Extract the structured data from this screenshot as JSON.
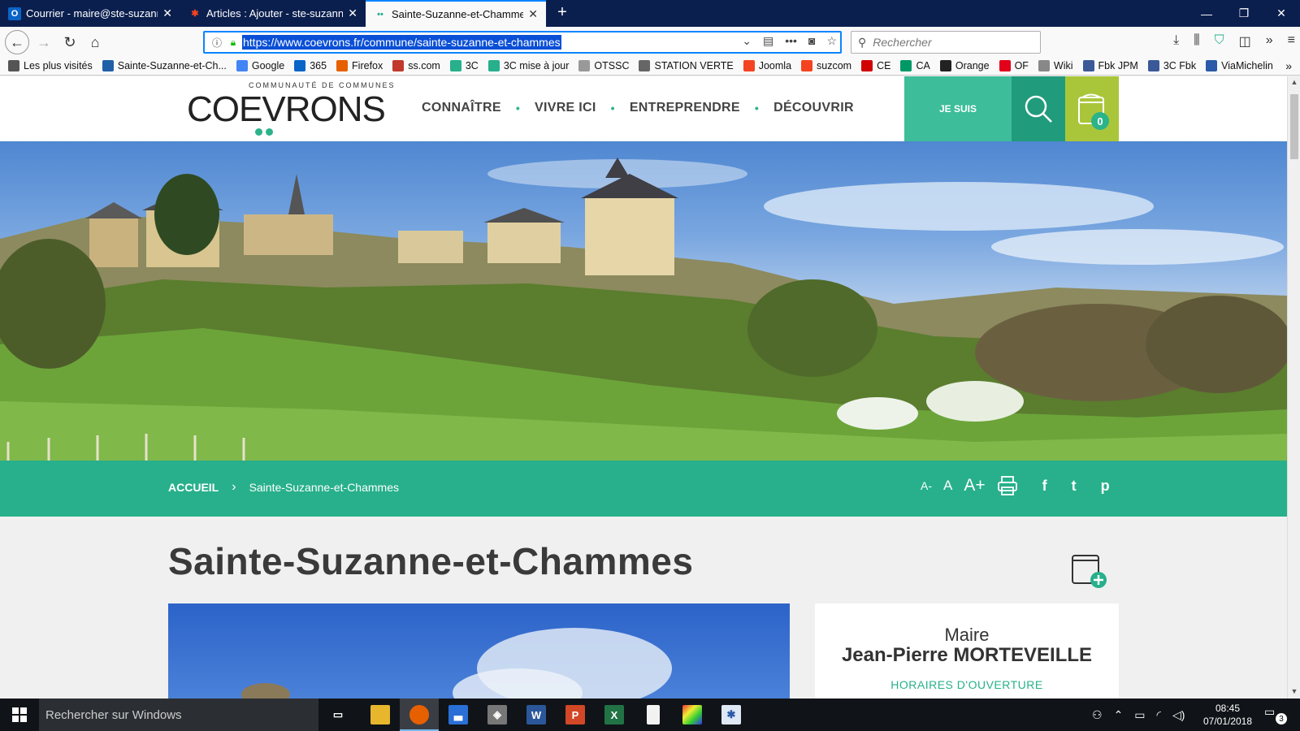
{
  "browser": {
    "tabs": [
      {
        "title": "Courrier - maire@ste-suzanne.c",
        "icon": "outlook-icon",
        "active": false
      },
      {
        "title": "Articles : Ajouter - ste-suzanne.",
        "icon": "joomla-icon",
        "active": false
      },
      {
        "title": "Sainte-Suzanne-et-Chammes |",
        "icon": "coevrons-dots-icon",
        "active": true
      }
    ],
    "url": "https://www.coevrons.fr/commune/sainte-suzanne-et-chammes",
    "search_placeholder": "Rechercher",
    "bookmarks": [
      {
        "label": "Les plus visités",
        "icon": "gear-icon",
        "color": "#555555"
      },
      {
        "label": "Sainte-Suzanne-et-Ch...",
        "icon": "site-icon",
        "color": "#1f5fa8"
      },
      {
        "label": "Google",
        "icon": "google-icon",
        "color": "#4285f4"
      },
      {
        "label": "365",
        "icon": "outlook-icon",
        "color": "#0a64c8"
      },
      {
        "label": "Firefox",
        "icon": "firefox-icon",
        "color": "#e66000"
      },
      {
        "label": "ss.com",
        "icon": "ss-icon",
        "color": "#c0392b"
      },
      {
        "label": "3C",
        "icon": "dots-icon",
        "color": "#27b08b"
      },
      {
        "label": "3C mise à jour",
        "icon": "dots-icon",
        "color": "#27b08b"
      },
      {
        "label": "OTSSC",
        "icon": "otssc-icon",
        "color": "#999999"
      },
      {
        "label": "STATION VERTE",
        "icon": "globe-icon",
        "color": "#666666"
      },
      {
        "label": "Joomla",
        "icon": "joomla-icon",
        "color": "#f44321"
      },
      {
        "label": "suzcom",
        "icon": "joomla-icon",
        "color": "#f44321"
      },
      {
        "label": "CE",
        "icon": "ce-icon",
        "color": "#d00000"
      },
      {
        "label": "CA",
        "icon": "ca-icon",
        "color": "#009966"
      },
      {
        "label": "Orange",
        "icon": "orange-icon",
        "color": "#222222"
      },
      {
        "label": "OF",
        "icon": "of-icon",
        "color": "#e2001a"
      },
      {
        "label": "Wiki",
        "icon": "wiki-icon",
        "color": "#888888"
      },
      {
        "label": "Fbk JPM",
        "icon": "facebook-icon",
        "color": "#3b5998"
      },
      {
        "label": "3C Fbk",
        "icon": "facebook-icon",
        "color": "#3b5998"
      },
      {
        "label": "ViaMichelin",
        "icon": "viamichelin-icon",
        "color": "#2a5aa8"
      }
    ]
  },
  "site": {
    "logo_small": "COMMUNAUTÉ DE COMMUNES",
    "logo_big": "COEVRONS",
    "nav": [
      "CONNAÎTRE",
      "VIVRE ICI",
      "ENTREPRENDRE",
      "DÉCOUVRIR"
    ],
    "je_suis": "JE SUIS",
    "cart_count": "0",
    "breadcrumb_home": "ACCUEIL",
    "breadcrumb_current": "Sainte-Suzanne-et-Chammes",
    "font_small": "A-",
    "font_normal": "A",
    "font_large": "A+",
    "social": {
      "facebook": "f",
      "twitter": "t",
      "pinterest": "p"
    },
    "page_title": "Sainte-Suzanne-et-Chammes",
    "mayor_role": "Maire",
    "mayor_name": "Jean-Pierre MORTEVEILLE",
    "hours_link": "HORAIRES D'OUVERTURE"
  },
  "colors": {
    "brand_green": "#27b08b",
    "jesuis_green": "#3dbd9a",
    "search_green": "#209b7c",
    "cart_lime": "#a9c63a"
  },
  "taskbar": {
    "search_placeholder": "Rechercher sur Windows",
    "time": "08:45",
    "date": "07/01/2018",
    "notifications": "3"
  }
}
